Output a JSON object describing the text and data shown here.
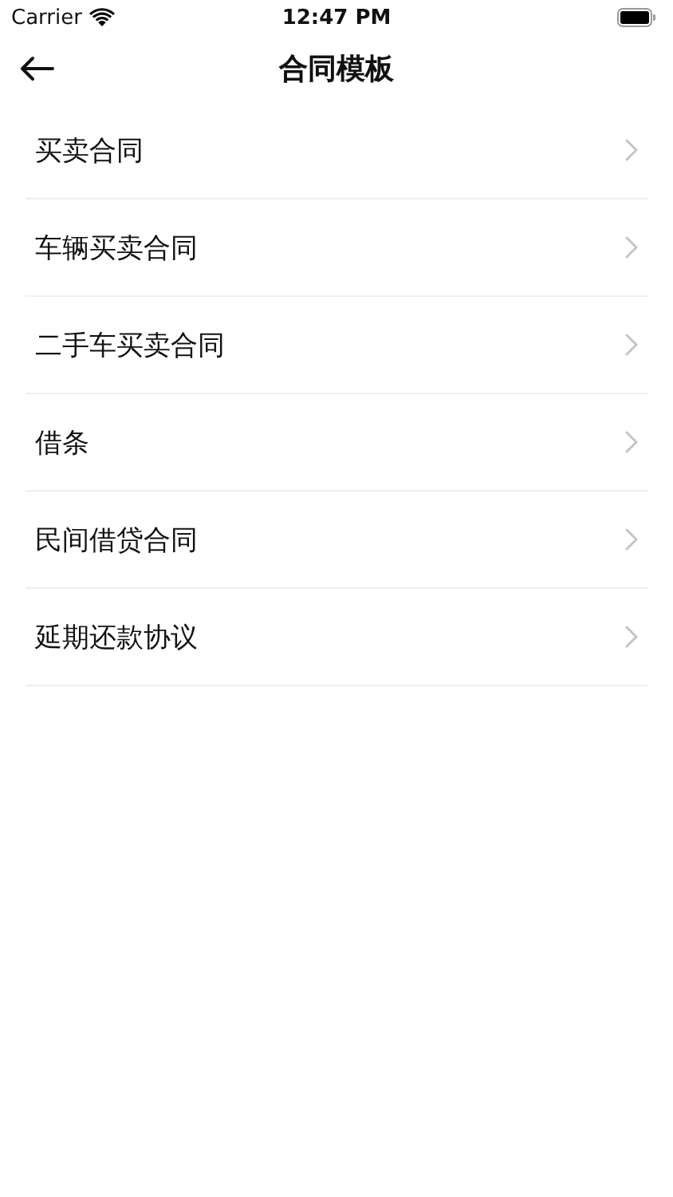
{
  "status_bar": {
    "carrier": "Carrier",
    "time": "12:47 PM"
  },
  "nav": {
    "title": "合同模板"
  },
  "items": [
    {
      "label": "买卖合同"
    },
    {
      "label": "车辆买卖合同"
    },
    {
      "label": "二手车买卖合同"
    },
    {
      "label": "借条"
    },
    {
      "label": "民间借贷合同"
    },
    {
      "label": "延期还款协议"
    }
  ]
}
